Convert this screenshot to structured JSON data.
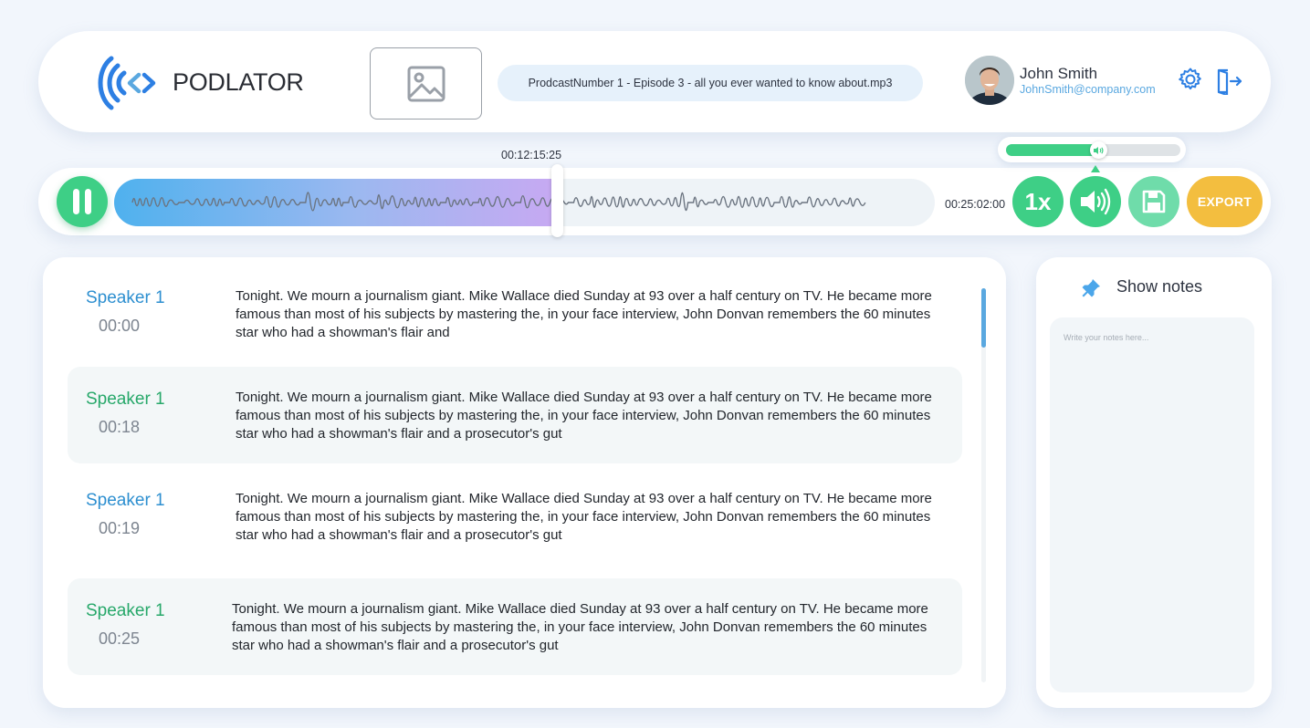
{
  "brand": {
    "name": "PODLATOR",
    "accent": "#2d7fe3"
  },
  "header": {
    "file_name": "ProdcastNumber 1 - Episode 3 - all you ever wanted to know about.mp3",
    "user": {
      "name": "John Smith",
      "email": "JohnSmith@company.com"
    },
    "icons": {
      "thumbnail": "image-placeholder-icon",
      "settings": "gear-icon",
      "logout": "logout-icon"
    }
  },
  "player": {
    "current_time": "00:12:15:25",
    "duration": "00:25:02:00",
    "progress": 0.54,
    "speed_label": "1x",
    "volume": 0.49,
    "export_label": "EXPORT",
    "colors": {
      "green": "#3ecf86",
      "light_green": "#6fdcaa",
      "export": "#f3be3f",
      "played_start": "#4fb1ee",
      "played_end": "#c7a9f2"
    }
  },
  "transcript": {
    "scroll_position": 0,
    "entries": [
      {
        "speaker": "Speaker 1",
        "time": "00:00",
        "text": "Tonight. We mourn a journalism giant. Mike Wallace died Sunday at 93 over a half century on TV. He became more famous than most of his subjects by mastering the, in your face interview, John Donvan remembers the 60 minutes star who had a showman's flair and",
        "speaker_color": "#2d8fd0"
      },
      {
        "speaker": "Speaker 1",
        "time": "00:18",
        "text": "Tonight. We mourn a journalism giant. Mike Wallace died Sunday at 93 over a half century on TV. He became more famous than most of his subjects by mastering the, in your face interview, John Donvan remembers the 60 minutes star who had a showman's flair and a prosecutor's gut",
        "speaker_color": "#27a86a"
      },
      {
        "speaker": "Speaker 1",
        "time": "00:19",
        "text": "Tonight. We mourn a journalism giant. Mike Wallace died Sunday at 93 over a half century on TV. He became more famous than most of his subjects by mastering the, in your face interview, John Donvan remembers the 60 minutes star who had a showman's flair and a prosecutor's gut",
        "speaker_color": "#2d8fd0"
      },
      {
        "speaker": "Speaker 1",
        "time": "00:25",
        "text": "Tonight. We mourn a journalism giant. Mike Wallace died Sunday at 93 over a half century on TV. He became more famous than most of his subjects by mastering the, in your face interview, John Donvan remembers the 60 minutes star who had a showman's flair and a prosecutor's gut",
        "speaker_color": "#27a86a"
      }
    ]
  },
  "notes": {
    "title": "Show notes",
    "placeholder": "Write your notes here...",
    "value": ""
  }
}
